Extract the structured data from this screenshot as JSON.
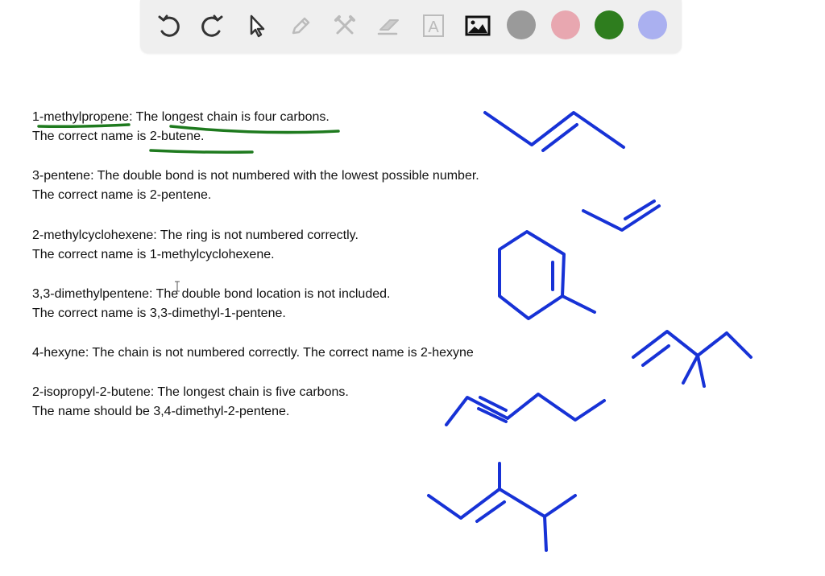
{
  "toolbar": {
    "tools": [
      {
        "name": "undo",
        "icon": "undo-icon"
      },
      {
        "name": "redo",
        "icon": "redo-icon"
      },
      {
        "name": "select",
        "icon": "pointer-icon"
      },
      {
        "name": "pen",
        "icon": "pencil-icon"
      },
      {
        "name": "tools",
        "icon": "tools-icon"
      },
      {
        "name": "eraser",
        "icon": "eraser-icon"
      },
      {
        "name": "text",
        "icon": "text-icon",
        "label": "A"
      },
      {
        "name": "image",
        "icon": "image-icon"
      }
    ],
    "colors": [
      "#9a9a9a",
      "#e8a7b0",
      "#2e7d1e",
      "#aab0f0"
    ]
  },
  "notes": {
    "line1": "1-methylpropene: The longest chain is four carbons.",
    "line2": "The correct name is 2-butene.",
    "line3": "3-pentene: The double bond is not numbered with the lowest possible number.",
    "line4": "The correct name is 2-pentene.",
    "line5": "2-methylcyclohexene: The ring is not numbered correctly.",
    "line6": "The correct name is 1-methylcyclohexene.",
    "line7": "3,3-dimethylpentene: The double bond location is not included.",
    "line8": "The correct name is 3,3-dimethyl-1-pentene.",
    "line9": "4-hexyne: The chain is not numbered correctly. The correct name is 2-hexyne",
    "line10": "2-isopropyl-2-butene: The longest chain is five carbons.",
    "line11": "The name should be 3,4-dimethyl-2-pentene."
  },
  "colors": {
    "ink_blue": "#1732d6",
    "ink_green": "#1e7a1e"
  }
}
